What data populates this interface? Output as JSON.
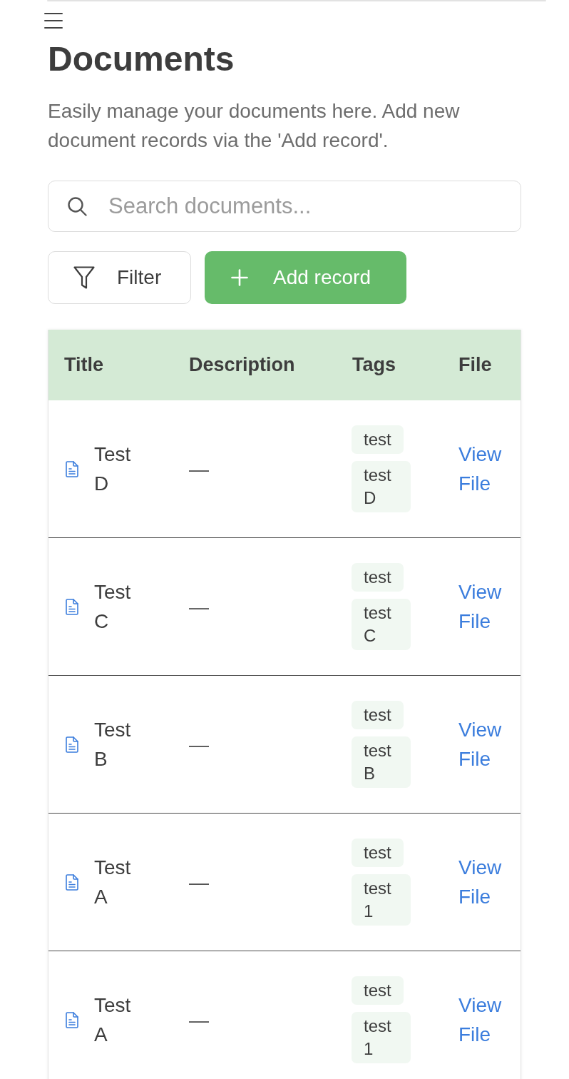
{
  "page": {
    "title": "Documents",
    "description": "Easily manage your documents here. Add new document records via the 'Add record'."
  },
  "search": {
    "placeholder": "Search documents..."
  },
  "toolbar": {
    "buttons": [
      {
        "kind": "filter",
        "label": "Filter"
      },
      {
        "kind": "add",
        "label": "Add record"
      }
    ]
  },
  "table": {
    "columns": [
      "Title",
      "Description",
      "Tags",
      "File"
    ],
    "rows": [
      {
        "title": "Test D",
        "description": "—",
        "tags": [
          "test",
          "test D"
        ],
        "file": "View File"
      },
      {
        "title": "Test C",
        "description": "—",
        "tags": [
          "test",
          "test C"
        ],
        "file": "View File"
      },
      {
        "title": "Test B",
        "description": "—",
        "tags": [
          "test",
          "test B"
        ],
        "file": "View File"
      },
      {
        "title": "Test A",
        "description": "—",
        "tags": [
          "test",
          "test 1"
        ],
        "file": "View File"
      },
      {
        "title": "Test A",
        "description": "—",
        "tags": [
          "test",
          "test 1"
        ],
        "file": "View File"
      }
    ]
  }
}
